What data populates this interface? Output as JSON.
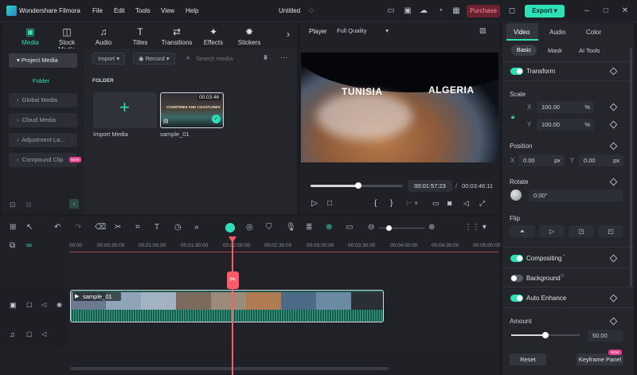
{
  "app": {
    "name": "Wondershare Filmora",
    "doc_title": "Untitled",
    "menus": [
      "File",
      "Edit",
      "Tools",
      "View",
      "Help"
    ],
    "purchase": "Purchase",
    "export": "Export"
  },
  "media_tabs": [
    {
      "label": "Media",
      "icon": "media-icon"
    },
    {
      "label": "Stock Media",
      "icon": "stock-icon"
    },
    {
      "label": "Audio",
      "icon": "music-icon"
    },
    {
      "label": "Titles",
      "icon": "titles-icon"
    },
    {
      "label": "Transitions",
      "icon": "transitions-icon"
    },
    {
      "label": "Effects",
      "icon": "effects-icon"
    },
    {
      "label": "Stickers",
      "icon": "stickers-icon"
    }
  ],
  "sidebar": {
    "project_media": "Project Media",
    "folder": "Folder",
    "items": [
      "Global Media",
      "Cloud Media",
      "Adjustment La...",
      "Compound Clip"
    ],
    "new_badge": "NEW"
  },
  "media_toolbar": {
    "import": "Import",
    "record": "Record",
    "search_placeholder": "Search media"
  },
  "media": {
    "folder_label": "FOLDER",
    "import_label": "Import Media",
    "clip_name": "sample_01",
    "clip_duration": "00:03:46",
    "thumb_caption": "COUNTRIES AND COASTLINES"
  },
  "player": {
    "label": "Player",
    "quality": "Full Quality",
    "overlay_left": "TUNISIA",
    "overlay_right": "ALGERIA",
    "current_time": "00:01:57:23",
    "total_time": "00:03:46:11",
    "progress": 0.52
  },
  "props": {
    "tabs": [
      "Video",
      "Audio",
      "Color"
    ],
    "subtabs": [
      "Basic",
      "Mask",
      "AI Tools"
    ],
    "transform": "Transform",
    "scale": {
      "label": "Scale",
      "x": "100.00",
      "y": "100.00",
      "unit": "%"
    },
    "position": {
      "label": "Position",
      "x": "0.00",
      "y": "0.00",
      "unit": "px"
    },
    "rotate": {
      "label": "Rotate",
      "value": "0.00°"
    },
    "flip": "Flip",
    "compositing": "Compositing",
    "background": "Background",
    "auto_enhance": "Auto Enhance",
    "amount": {
      "label": "Amount",
      "value": "50.00",
      "level": 0.5
    },
    "reset": "Reset",
    "keyframe": "Keyframe Panel",
    "new_badge": "NEW"
  },
  "timeline": {
    "ruler": [
      "00:00",
      "00:00:30:00",
      "00:01:00:00",
      "00:01:30:00",
      "00:02:00:00",
      "00:02:30:00",
      "00:03:00:00",
      "00:03:30:00",
      "00:04:00:00",
      "00:04:30:00",
      "00:05:00:00"
    ],
    "clip_label": "sample_01"
  },
  "colors": {
    "accent": "#2ee0b7",
    "playhead": "#ff5a6a",
    "purchase_bg": "#6b2230"
  }
}
